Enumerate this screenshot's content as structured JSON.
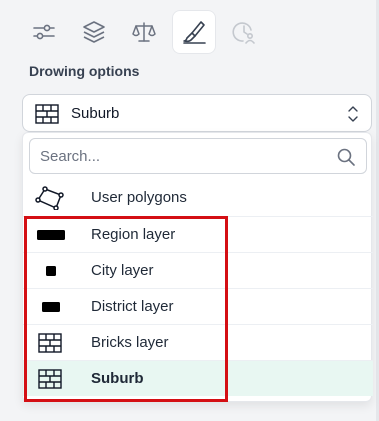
{
  "toolbar": {
    "tools": [
      {
        "icon": "sliders-icon",
        "active": false
      },
      {
        "icon": "layers-icon",
        "active": false
      },
      {
        "icon": "scale-icon",
        "active": false
      },
      {
        "icon": "drawing-brush-icon",
        "active": true
      },
      {
        "icon": "clock-user-icon",
        "active": false,
        "disabled": true
      }
    ]
  },
  "section": {
    "title": "Drowing options"
  },
  "select": {
    "value": "Suburb",
    "icon": "bricks-icon"
  },
  "dropdown": {
    "search_placeholder": "Search...",
    "items": [
      {
        "label": "User polygons",
        "icon": "polygon-icon",
        "selected": false
      },
      {
        "label": "Region layer",
        "icon": "wide-rectangle-icon",
        "selected": false
      },
      {
        "label": "City layer",
        "icon": "small-square-icon",
        "selected": false
      },
      {
        "label": "District layer",
        "icon": "rectangle-icon",
        "selected": false
      },
      {
        "label": "Bricks layer",
        "icon": "bricks-icon",
        "selected": false
      },
      {
        "label": "Suburb",
        "icon": "bricks-icon",
        "selected": true
      }
    ]
  },
  "colors": {
    "accent_selected_bg": "#e8f7f2",
    "highlight_border": "#d40f14"
  }
}
